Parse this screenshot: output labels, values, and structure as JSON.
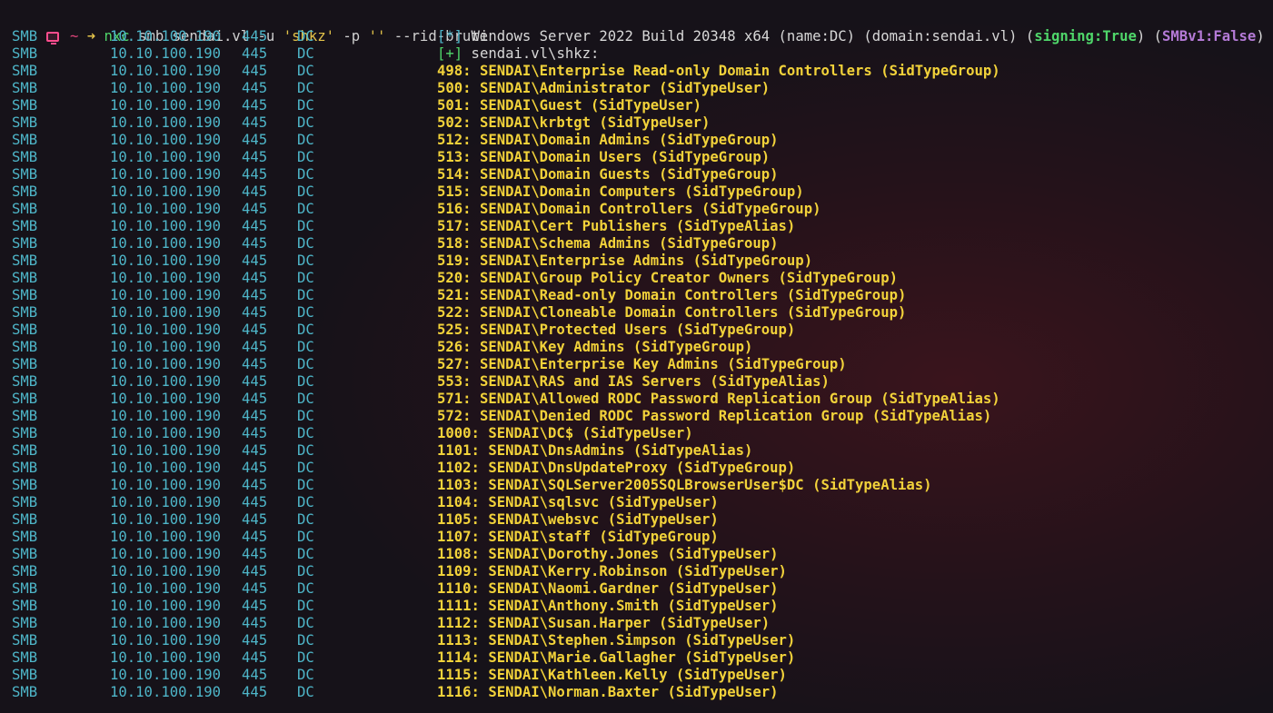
{
  "prompt": {
    "tilde": "~",
    "arrow": "➜",
    "command": "nxc",
    "args_before": " smb sendai.vl -u ",
    "user_str": "'shkz'",
    "mid": " -p ",
    "pass_str": "''",
    "args_after": " --rid-brute"
  },
  "banner": {
    "proto": "SMB",
    "ip": "10.10.100.190",
    "port": "445",
    "host": "DC",
    "tag": "[*]",
    "text_before": " Windows Server 2022 Build 20348 x64 (name:DC) (domain:sendai.vl) (",
    "signing": "signing:True",
    "text_mid": ") (",
    "smbv1": "SMBv1:False",
    "text_after": ")"
  },
  "auth": {
    "proto": "SMB",
    "ip": "10.10.100.190",
    "port": "445",
    "host": "DC",
    "tag": "[+]",
    "text": " sendai.vl\\shkz:"
  },
  "rows": [
    {
      "proto": "SMB",
      "ip": "10.10.100.190",
      "port": "445",
      "host": "DC",
      "msg": "498: SENDAI\\Enterprise Read-only Domain Controllers (SidTypeGroup)"
    },
    {
      "proto": "SMB",
      "ip": "10.10.100.190",
      "port": "445",
      "host": "DC",
      "msg": "500: SENDAI\\Administrator (SidTypeUser)"
    },
    {
      "proto": "SMB",
      "ip": "10.10.100.190",
      "port": "445",
      "host": "DC",
      "msg": "501: SENDAI\\Guest (SidTypeUser)"
    },
    {
      "proto": "SMB",
      "ip": "10.10.100.190",
      "port": "445",
      "host": "DC",
      "msg": "502: SENDAI\\krbtgt (SidTypeUser)"
    },
    {
      "proto": "SMB",
      "ip": "10.10.100.190",
      "port": "445",
      "host": "DC",
      "msg": "512: SENDAI\\Domain Admins (SidTypeGroup)"
    },
    {
      "proto": "SMB",
      "ip": "10.10.100.190",
      "port": "445",
      "host": "DC",
      "msg": "513: SENDAI\\Domain Users (SidTypeGroup)"
    },
    {
      "proto": "SMB",
      "ip": "10.10.100.190",
      "port": "445",
      "host": "DC",
      "msg": "514: SENDAI\\Domain Guests (SidTypeGroup)"
    },
    {
      "proto": "SMB",
      "ip": "10.10.100.190",
      "port": "445",
      "host": "DC",
      "msg": "515: SENDAI\\Domain Computers (SidTypeGroup)"
    },
    {
      "proto": "SMB",
      "ip": "10.10.100.190",
      "port": "445",
      "host": "DC",
      "msg": "516: SENDAI\\Domain Controllers (SidTypeGroup)"
    },
    {
      "proto": "SMB",
      "ip": "10.10.100.190",
      "port": "445",
      "host": "DC",
      "msg": "517: SENDAI\\Cert Publishers (SidTypeAlias)"
    },
    {
      "proto": "SMB",
      "ip": "10.10.100.190",
      "port": "445",
      "host": "DC",
      "msg": "518: SENDAI\\Schema Admins (SidTypeGroup)"
    },
    {
      "proto": "SMB",
      "ip": "10.10.100.190",
      "port": "445",
      "host": "DC",
      "msg": "519: SENDAI\\Enterprise Admins (SidTypeGroup)"
    },
    {
      "proto": "SMB",
      "ip": "10.10.100.190",
      "port": "445",
      "host": "DC",
      "msg": "520: SENDAI\\Group Policy Creator Owners (SidTypeGroup)"
    },
    {
      "proto": "SMB",
      "ip": "10.10.100.190",
      "port": "445",
      "host": "DC",
      "msg": "521: SENDAI\\Read-only Domain Controllers (SidTypeGroup)"
    },
    {
      "proto": "SMB",
      "ip": "10.10.100.190",
      "port": "445",
      "host": "DC",
      "msg": "522: SENDAI\\Cloneable Domain Controllers (SidTypeGroup)"
    },
    {
      "proto": "SMB",
      "ip": "10.10.100.190",
      "port": "445",
      "host": "DC",
      "msg": "525: SENDAI\\Protected Users (SidTypeGroup)"
    },
    {
      "proto": "SMB",
      "ip": "10.10.100.190",
      "port": "445",
      "host": "DC",
      "msg": "526: SENDAI\\Key Admins (SidTypeGroup)"
    },
    {
      "proto": "SMB",
      "ip": "10.10.100.190",
      "port": "445",
      "host": "DC",
      "msg": "527: SENDAI\\Enterprise Key Admins (SidTypeGroup)"
    },
    {
      "proto": "SMB",
      "ip": "10.10.100.190",
      "port": "445",
      "host": "DC",
      "msg": "553: SENDAI\\RAS and IAS Servers (SidTypeAlias)"
    },
    {
      "proto": "SMB",
      "ip": "10.10.100.190",
      "port": "445",
      "host": "DC",
      "msg": "571: SENDAI\\Allowed RODC Password Replication Group (SidTypeAlias)"
    },
    {
      "proto": "SMB",
      "ip": "10.10.100.190",
      "port": "445",
      "host": "DC",
      "msg": "572: SENDAI\\Denied RODC Password Replication Group (SidTypeAlias)"
    },
    {
      "proto": "SMB",
      "ip": "10.10.100.190",
      "port": "445",
      "host": "DC",
      "msg": "1000: SENDAI\\DC$ (SidTypeUser)"
    },
    {
      "proto": "SMB",
      "ip": "10.10.100.190",
      "port": "445",
      "host": "DC",
      "msg": "1101: SENDAI\\DnsAdmins (SidTypeAlias)"
    },
    {
      "proto": "SMB",
      "ip": "10.10.100.190",
      "port": "445",
      "host": "DC",
      "msg": "1102: SENDAI\\DnsUpdateProxy (SidTypeGroup)"
    },
    {
      "proto": "SMB",
      "ip": "10.10.100.190",
      "port": "445",
      "host": "DC",
      "msg": "1103: SENDAI\\SQLServer2005SQLBrowserUser$DC (SidTypeAlias)"
    },
    {
      "proto": "SMB",
      "ip": "10.10.100.190",
      "port": "445",
      "host": "DC",
      "msg": "1104: SENDAI\\sqlsvc (SidTypeUser)"
    },
    {
      "proto": "SMB",
      "ip": "10.10.100.190",
      "port": "445",
      "host": "DC",
      "msg": "1105: SENDAI\\websvc (SidTypeUser)"
    },
    {
      "proto": "SMB",
      "ip": "10.10.100.190",
      "port": "445",
      "host": "DC",
      "msg": "1107: SENDAI\\staff (SidTypeGroup)"
    },
    {
      "proto": "SMB",
      "ip": "10.10.100.190",
      "port": "445",
      "host": "DC",
      "msg": "1108: SENDAI\\Dorothy.Jones (SidTypeUser)"
    },
    {
      "proto": "SMB",
      "ip": "10.10.100.190",
      "port": "445",
      "host": "DC",
      "msg": "1109: SENDAI\\Kerry.Robinson (SidTypeUser)"
    },
    {
      "proto": "SMB",
      "ip": "10.10.100.190",
      "port": "445",
      "host": "DC",
      "msg": "1110: SENDAI\\Naomi.Gardner (SidTypeUser)"
    },
    {
      "proto": "SMB",
      "ip": "10.10.100.190",
      "port": "445",
      "host": "DC",
      "msg": "1111: SENDAI\\Anthony.Smith (SidTypeUser)"
    },
    {
      "proto": "SMB",
      "ip": "10.10.100.190",
      "port": "445",
      "host": "DC",
      "msg": "1112: SENDAI\\Susan.Harper (SidTypeUser)"
    },
    {
      "proto": "SMB",
      "ip": "10.10.100.190",
      "port": "445",
      "host": "DC",
      "msg": "1113: SENDAI\\Stephen.Simpson (SidTypeUser)"
    },
    {
      "proto": "SMB",
      "ip": "10.10.100.190",
      "port": "445",
      "host": "DC",
      "msg": "1114: SENDAI\\Marie.Gallagher (SidTypeUser)"
    },
    {
      "proto": "SMB",
      "ip": "10.10.100.190",
      "port": "445",
      "host": "DC",
      "msg": "1115: SENDAI\\Kathleen.Kelly (SidTypeUser)"
    },
    {
      "proto": "SMB",
      "ip": "10.10.100.190",
      "port": "445",
      "host": "DC",
      "msg": "1116: SENDAI\\Norman.Baxter (SidTypeUser)"
    }
  ],
  "colors": {
    "background": "#16121a",
    "prompt_icon": "#ff4d8d",
    "column_cyan": "#4eb6c9",
    "success_green": "#4fd66a",
    "rid_yellow": "#f2d23a",
    "smbv1_purple": "#b47ad6"
  },
  "icons": {
    "prompt_icon": "terminal-monitor-icon"
  }
}
